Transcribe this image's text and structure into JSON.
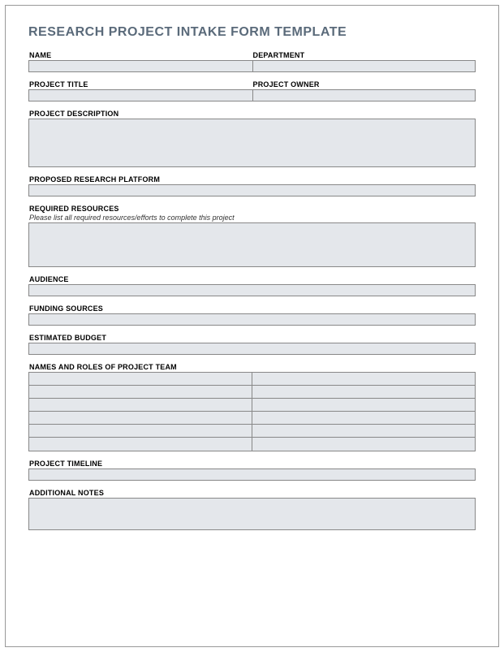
{
  "title": "RESEARCH PROJECT INTAKE FORM TEMPLATE",
  "labels": {
    "name": "NAME",
    "department": "DEPARTMENT",
    "projectTitle": "PROJECT TITLE",
    "projectOwner": "PROJECT OWNER",
    "projectDescription": "PROJECT DESCRIPTION",
    "proposedPlatform": "PROPOSED RESEARCH PLATFORM",
    "requiredResources": "REQUIRED RESOURCES",
    "requiredResourcesHint": "Please list all required resources/efforts to complete this project",
    "audience": "AUDIENCE",
    "fundingSources": "FUNDING SOURCES",
    "estimatedBudget": "ESTIMATED BUDGET",
    "teamRoles": "NAMES AND ROLES OF PROJECT TEAM",
    "projectTimeline": "PROJECT TIMELINE",
    "additionalNotes": "ADDITIONAL NOTES"
  },
  "values": {
    "name": "",
    "department": "",
    "projectTitle": "",
    "projectOwner": "",
    "projectDescription": "",
    "proposedPlatform": "",
    "requiredResources": "",
    "audience": "",
    "fundingSources": "",
    "estimatedBudget": "",
    "projectTimeline": "",
    "additionalNotes": "",
    "teamRows": [
      {
        "name": "",
        "role": ""
      },
      {
        "name": "",
        "role": ""
      },
      {
        "name": "",
        "role": ""
      },
      {
        "name": "",
        "role": ""
      },
      {
        "name": "",
        "role": ""
      },
      {
        "name": "",
        "role": ""
      }
    ]
  }
}
